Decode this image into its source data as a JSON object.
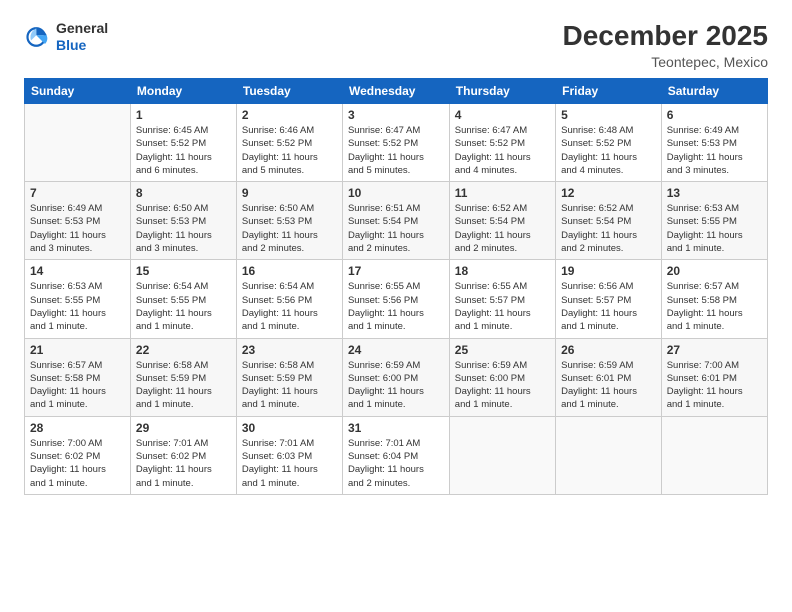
{
  "header": {
    "logo_general": "General",
    "logo_blue": "Blue",
    "month_title": "December 2025",
    "location": "Teontepec, Mexico"
  },
  "weekdays": [
    "Sunday",
    "Monday",
    "Tuesday",
    "Wednesday",
    "Thursday",
    "Friday",
    "Saturday"
  ],
  "weeks": [
    [
      {
        "day": "",
        "info": ""
      },
      {
        "day": "1",
        "info": "Sunrise: 6:45 AM\nSunset: 5:52 PM\nDaylight: 11 hours\nand 6 minutes."
      },
      {
        "day": "2",
        "info": "Sunrise: 6:46 AM\nSunset: 5:52 PM\nDaylight: 11 hours\nand 5 minutes."
      },
      {
        "day": "3",
        "info": "Sunrise: 6:47 AM\nSunset: 5:52 PM\nDaylight: 11 hours\nand 5 minutes."
      },
      {
        "day": "4",
        "info": "Sunrise: 6:47 AM\nSunset: 5:52 PM\nDaylight: 11 hours\nand 4 minutes."
      },
      {
        "day": "5",
        "info": "Sunrise: 6:48 AM\nSunset: 5:52 PM\nDaylight: 11 hours\nand 4 minutes."
      },
      {
        "day": "6",
        "info": "Sunrise: 6:49 AM\nSunset: 5:53 PM\nDaylight: 11 hours\nand 3 minutes."
      }
    ],
    [
      {
        "day": "7",
        "info": "Sunrise: 6:49 AM\nSunset: 5:53 PM\nDaylight: 11 hours\nand 3 minutes."
      },
      {
        "day": "8",
        "info": "Sunrise: 6:50 AM\nSunset: 5:53 PM\nDaylight: 11 hours\nand 3 minutes."
      },
      {
        "day": "9",
        "info": "Sunrise: 6:50 AM\nSunset: 5:53 PM\nDaylight: 11 hours\nand 2 minutes."
      },
      {
        "day": "10",
        "info": "Sunrise: 6:51 AM\nSunset: 5:54 PM\nDaylight: 11 hours\nand 2 minutes."
      },
      {
        "day": "11",
        "info": "Sunrise: 6:52 AM\nSunset: 5:54 PM\nDaylight: 11 hours\nand 2 minutes."
      },
      {
        "day": "12",
        "info": "Sunrise: 6:52 AM\nSunset: 5:54 PM\nDaylight: 11 hours\nand 2 minutes."
      },
      {
        "day": "13",
        "info": "Sunrise: 6:53 AM\nSunset: 5:55 PM\nDaylight: 11 hours\nand 1 minute."
      }
    ],
    [
      {
        "day": "14",
        "info": "Sunrise: 6:53 AM\nSunset: 5:55 PM\nDaylight: 11 hours\nand 1 minute."
      },
      {
        "day": "15",
        "info": "Sunrise: 6:54 AM\nSunset: 5:55 PM\nDaylight: 11 hours\nand 1 minute."
      },
      {
        "day": "16",
        "info": "Sunrise: 6:54 AM\nSunset: 5:56 PM\nDaylight: 11 hours\nand 1 minute."
      },
      {
        "day": "17",
        "info": "Sunrise: 6:55 AM\nSunset: 5:56 PM\nDaylight: 11 hours\nand 1 minute."
      },
      {
        "day": "18",
        "info": "Sunrise: 6:55 AM\nSunset: 5:57 PM\nDaylight: 11 hours\nand 1 minute."
      },
      {
        "day": "19",
        "info": "Sunrise: 6:56 AM\nSunset: 5:57 PM\nDaylight: 11 hours\nand 1 minute."
      },
      {
        "day": "20",
        "info": "Sunrise: 6:57 AM\nSunset: 5:58 PM\nDaylight: 11 hours\nand 1 minute."
      }
    ],
    [
      {
        "day": "21",
        "info": "Sunrise: 6:57 AM\nSunset: 5:58 PM\nDaylight: 11 hours\nand 1 minute."
      },
      {
        "day": "22",
        "info": "Sunrise: 6:58 AM\nSunset: 5:59 PM\nDaylight: 11 hours\nand 1 minute."
      },
      {
        "day": "23",
        "info": "Sunrise: 6:58 AM\nSunset: 5:59 PM\nDaylight: 11 hours\nand 1 minute."
      },
      {
        "day": "24",
        "info": "Sunrise: 6:59 AM\nSunset: 6:00 PM\nDaylight: 11 hours\nand 1 minute."
      },
      {
        "day": "25",
        "info": "Sunrise: 6:59 AM\nSunset: 6:00 PM\nDaylight: 11 hours\nand 1 minute."
      },
      {
        "day": "26",
        "info": "Sunrise: 6:59 AM\nSunset: 6:01 PM\nDaylight: 11 hours\nand 1 minute."
      },
      {
        "day": "27",
        "info": "Sunrise: 7:00 AM\nSunset: 6:01 PM\nDaylight: 11 hours\nand 1 minute."
      }
    ],
    [
      {
        "day": "28",
        "info": "Sunrise: 7:00 AM\nSunset: 6:02 PM\nDaylight: 11 hours\nand 1 minute."
      },
      {
        "day": "29",
        "info": "Sunrise: 7:01 AM\nSunset: 6:02 PM\nDaylight: 11 hours\nand 1 minute."
      },
      {
        "day": "30",
        "info": "Sunrise: 7:01 AM\nSunset: 6:03 PM\nDaylight: 11 hours\nand 1 minute."
      },
      {
        "day": "31",
        "info": "Sunrise: 7:01 AM\nSunset: 6:04 PM\nDaylight: 11 hours\nand 2 minutes."
      },
      {
        "day": "",
        "info": ""
      },
      {
        "day": "",
        "info": ""
      },
      {
        "day": "",
        "info": ""
      }
    ]
  ]
}
